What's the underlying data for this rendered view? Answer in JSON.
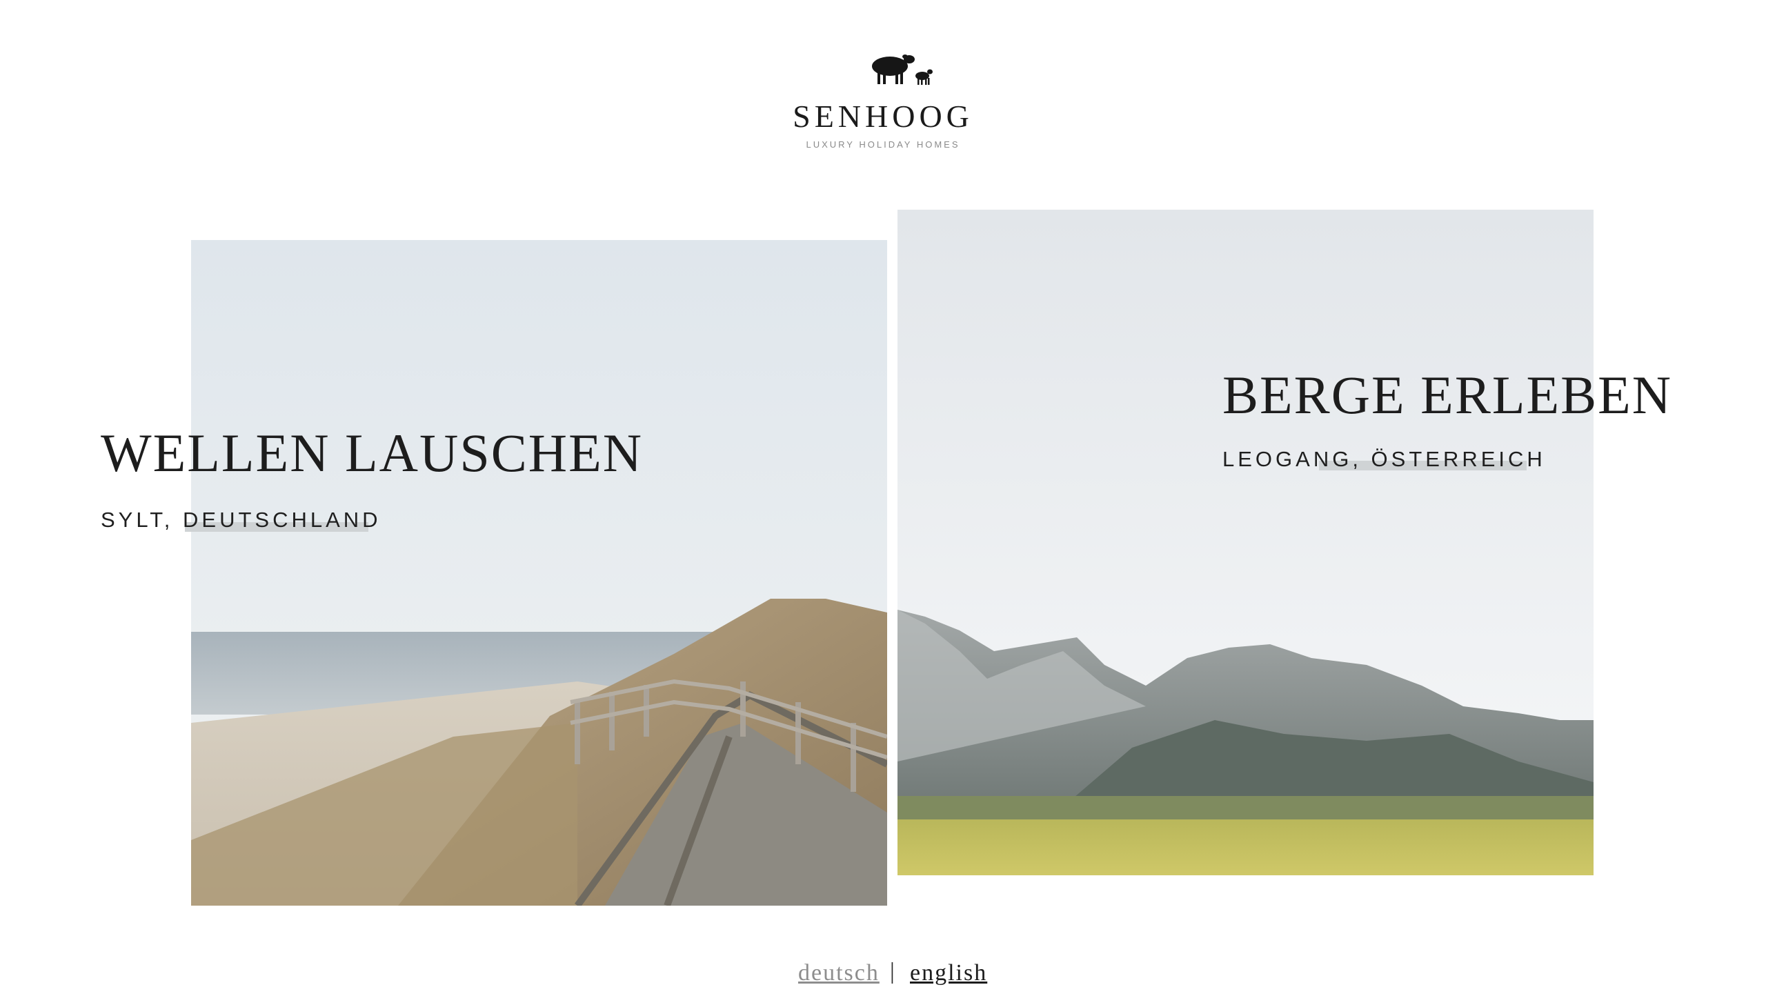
{
  "brand": {
    "name": "SENHOOG",
    "tagline": "LUXURY HOLIDAY HOMES",
    "logo_icon": "sheep-and-lamb-icon"
  },
  "destinations": [
    {
      "headline": "WELLEN LAUSCHEN",
      "location": "SYLT, DEUTSCHLAND",
      "image": "dune-boardwalk-beach-photo"
    },
    {
      "headline": "BERGE ERLEBEN",
      "location": "LEOGANG, ÖSTERREICH",
      "image": "alpine-mountain-meadow-photo"
    }
  ],
  "language_switch": {
    "options": [
      "deutsch",
      "english"
    ],
    "separator": "|",
    "active": "deutsch"
  },
  "colors": {
    "text": "#1d1d1d",
    "muted_link": "#8d8d8d",
    "accent_bar": "#cfd3d5",
    "background": "#ffffff"
  }
}
